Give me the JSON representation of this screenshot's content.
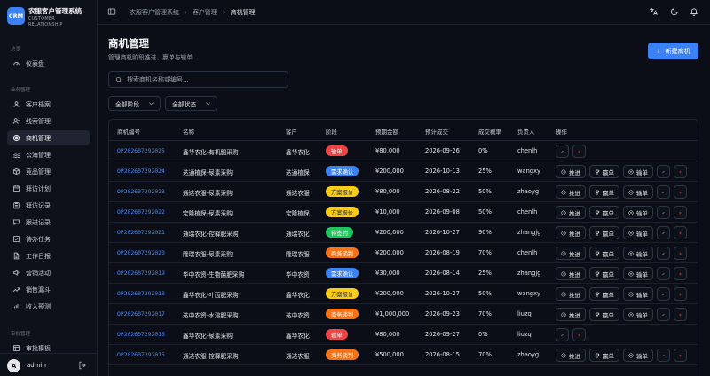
{
  "app": {
    "logo": "CRM",
    "title": "农服客户管理系统",
    "subtitle": "CUSTOMER RELATIONSHIP"
  },
  "sidebar": {
    "section_overview": "总览",
    "section_business": "业务管理",
    "section_approval": "审批管理",
    "overview_items": [
      {
        "label": "仪表盘",
        "icon": "dashboard-icon"
      }
    ],
    "items": [
      {
        "label": "客户档案",
        "icon": "user-icon"
      },
      {
        "label": "线索管理",
        "icon": "user-plus-icon"
      },
      {
        "label": "商机管理",
        "icon": "target-icon"
      },
      {
        "label": "公海管理",
        "icon": "waves-icon"
      },
      {
        "label": "竞品管理",
        "icon": "box-icon"
      },
      {
        "label": "拜访计划",
        "icon": "calendar-icon"
      },
      {
        "label": "拜访记录",
        "icon": "clipboard-icon"
      },
      {
        "label": "跟进记录",
        "icon": "message-icon"
      },
      {
        "label": "待办任务",
        "icon": "check-square-icon"
      },
      {
        "label": "工作日报",
        "icon": "file-icon"
      },
      {
        "label": "营销活动",
        "icon": "megaphone-icon"
      },
      {
        "label": "销售漏斗",
        "icon": "trend-icon"
      },
      {
        "label": "收入预测",
        "icon": "chart-up-icon"
      }
    ],
    "approval_items": [
      {
        "label": "审批模板",
        "icon": "template-icon"
      }
    ],
    "active": "商机管理"
  },
  "user": {
    "avatar": "A",
    "name": "admin"
  },
  "breadcrumb": [
    "农服客户管理系统",
    "客户管理",
    "商机管理"
  ],
  "page": {
    "title": "商机管理",
    "subtitle": "管理商机阶段推进、赢单与输单",
    "new_button": "新建商机"
  },
  "filters": {
    "search_placeholder": "搜索商机名称或编号...",
    "stage": "全部阶段",
    "status": "全部状态"
  },
  "table": {
    "columns": [
      "商机编号",
      "名称",
      "客户",
      "阶段",
      "预期金额",
      "预计成交",
      "成交概率",
      "负责人",
      "操作"
    ],
    "actions": {
      "advance": "推进",
      "win": "赢单",
      "lose": "输单"
    },
    "rows": [
      {
        "code": "OP202607292025",
        "name": "鑫华农化-有机肥采购",
        "customer": "鑫华农化",
        "stage": "输单",
        "stage_color": "red",
        "amount": "¥80,000",
        "date": "2026-09-26",
        "prob": "0%",
        "owner": "chenlh",
        "full": false
      },
      {
        "code": "OP202607292024",
        "name": "达通植保-尿素采购",
        "customer": "达通植保",
        "stage": "需求确认",
        "stage_color": "blue",
        "amount": "¥200,000",
        "date": "2026-10-13",
        "prob": "25%",
        "owner": "wangxy",
        "full": true
      },
      {
        "code": "OP202607292023",
        "name": "通达农服-尿素采购",
        "customer": "通达农服",
        "stage": "方案报价",
        "stage_color": "yellow",
        "amount": "¥80,000",
        "date": "2026-08-22",
        "prob": "50%",
        "owner": "zhaoyg",
        "full": true
      },
      {
        "code": "OP202607292022",
        "name": "宏隆植保-尿素采购",
        "customer": "宏隆植保",
        "stage": "方案报价",
        "stage_color": "yellow",
        "amount": "¥10,000",
        "date": "2026-09-08",
        "prob": "50%",
        "owner": "chenlh",
        "full": true
      },
      {
        "code": "OP202607292021",
        "name": "通瑞农化-控释肥采购",
        "customer": "通瑞农化",
        "stage": "待签约",
        "stage_color": "green",
        "amount": "¥200,000",
        "date": "2026-10-27",
        "prob": "90%",
        "owner": "zhangjg",
        "full": true
      },
      {
        "code": "OP202607292020",
        "name": "隆瑞农服-尿素采购",
        "customer": "隆瑞农服",
        "stage": "商务谈判",
        "stage_color": "orange",
        "amount": "¥200,000",
        "date": "2026-08-19",
        "prob": "70%",
        "owner": "chenlh",
        "full": true
      },
      {
        "code": "OP202607292019",
        "name": "华中农资-生物菌肥采购",
        "customer": "华中农资",
        "stage": "需求确认",
        "stage_color": "blue",
        "amount": "¥30,000",
        "date": "2026-08-14",
        "prob": "25%",
        "owner": "zhangjg",
        "full": true
      },
      {
        "code": "OP202607292018",
        "name": "鑫华农化-叶面肥采购",
        "customer": "鑫华农化",
        "stage": "方案报价",
        "stage_color": "yellow",
        "amount": "¥200,000",
        "date": "2026-10-27",
        "prob": "50%",
        "owner": "wangxy",
        "full": true
      },
      {
        "code": "OP202607292017",
        "name": "达中农资-水溶肥采购",
        "customer": "达中农资",
        "stage": "商务谈判",
        "stage_color": "orange",
        "amount": "¥1,000,000",
        "date": "2026-09-23",
        "prob": "70%",
        "owner": "liuzq",
        "full": true
      },
      {
        "code": "OP202607292016",
        "name": "鑫华农化-尿素采购",
        "customer": "鑫华农化",
        "stage": "输单",
        "stage_color": "red",
        "amount": "¥80,000",
        "date": "2026-09-27",
        "prob": "0%",
        "owner": "liuzq",
        "full": false
      },
      {
        "code": "OP202607292015",
        "name": "通达农服-控释肥采购",
        "customer": "通达农服",
        "stage": "商务谈判",
        "stage_color": "orange",
        "amount": "¥500,000",
        "date": "2026-08-15",
        "prob": "70%",
        "owner": "zhaoyg",
        "full": true
      }
    ]
  }
}
